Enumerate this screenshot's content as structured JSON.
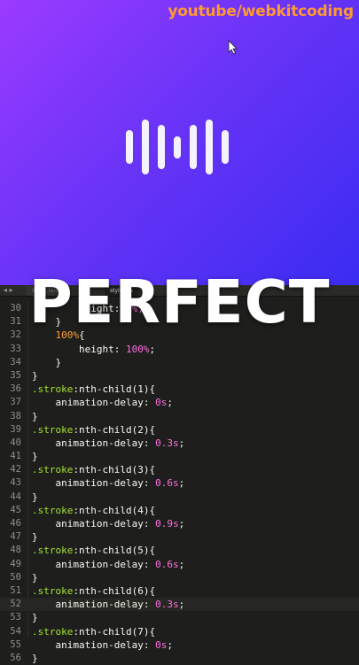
{
  "preview": {
    "watermark": "youtube/webkitcoding",
    "loader_levels": [
      0.62,
      1.0,
      0.8,
      0.4,
      0.8,
      1.0,
      0.62
    ]
  },
  "caption": "PERFECT",
  "editor": {
    "tabs": [
      {
        "label": "index.html",
        "active": false
      },
      {
        "label": "style.css",
        "active": true
      }
    ],
    "lines": [
      {
        "n": "30",
        "parts": [
          [
            "        height: ",
            "c-prop"
          ],
          [
            "0%;",
            "c-num"
          ]
        ]
      },
      {
        "n": "31",
        "parts": [
          [
            "    }",
            "c-white"
          ]
        ]
      },
      {
        "n": "32",
        "parts": [
          [
            "    ",
            "c-white"
          ],
          [
            "100%",
            "c-pct"
          ],
          [
            "{",
            "c-white"
          ]
        ]
      },
      {
        "n": "33",
        "parts": [
          [
            "        height: ",
            "c-prop"
          ],
          [
            "100%",
            "c-num"
          ],
          [
            ";",
            "c-white"
          ]
        ]
      },
      {
        "n": "34",
        "parts": [
          [
            "    }",
            "c-white"
          ]
        ]
      },
      {
        "n": "35",
        "parts": [
          [
            "}",
            "c-white"
          ]
        ]
      },
      {
        "n": "36",
        "parts": [
          [
            ".stroke",
            "c-sel"
          ],
          [
            ":nth-child(1){",
            "c-white"
          ]
        ]
      },
      {
        "n": "37",
        "parts": [
          [
            "    animation-delay: ",
            "c-prop"
          ],
          [
            "0s",
            "c-num"
          ],
          [
            ";",
            "c-white"
          ]
        ]
      },
      {
        "n": "38",
        "parts": [
          [
            "}",
            "c-white"
          ]
        ]
      },
      {
        "n": "39",
        "parts": [
          [
            ".stroke",
            "c-sel"
          ],
          [
            ":nth-child(2){",
            "c-white"
          ]
        ]
      },
      {
        "n": "40",
        "parts": [
          [
            "    animation-delay: ",
            "c-prop"
          ],
          [
            "0.3s",
            "c-num"
          ],
          [
            ";",
            "c-white"
          ]
        ]
      },
      {
        "n": "41",
        "parts": [
          [
            "}",
            "c-white"
          ]
        ]
      },
      {
        "n": "42",
        "parts": [
          [
            ".stroke",
            "c-sel"
          ],
          [
            ":nth-child(3){",
            "c-white"
          ]
        ]
      },
      {
        "n": "43",
        "parts": [
          [
            "    animation-delay: ",
            "c-prop"
          ],
          [
            "0.6s",
            "c-num"
          ],
          [
            ";",
            "c-white"
          ]
        ]
      },
      {
        "n": "44",
        "parts": [
          [
            "}",
            "c-white"
          ]
        ]
      },
      {
        "n": "45",
        "parts": [
          [
            ".stroke",
            "c-sel"
          ],
          [
            ":nth-child(4){",
            "c-white"
          ]
        ]
      },
      {
        "n": "46",
        "parts": [
          [
            "    animation-delay: ",
            "c-prop"
          ],
          [
            "0.9s",
            "c-num"
          ],
          [
            ";",
            "c-white"
          ]
        ]
      },
      {
        "n": "47",
        "parts": [
          [
            "}",
            "c-white"
          ]
        ]
      },
      {
        "n": "48",
        "parts": [
          [
            ".stroke",
            "c-sel"
          ],
          [
            ":nth-child(5){",
            "c-white"
          ]
        ]
      },
      {
        "n": "49",
        "parts": [
          [
            "    animation-delay: ",
            "c-prop"
          ],
          [
            "0.6s",
            "c-num"
          ],
          [
            ";",
            "c-white"
          ]
        ]
      },
      {
        "n": "50",
        "parts": [
          [
            "}",
            "c-white"
          ]
        ]
      },
      {
        "n": "51",
        "parts": [
          [
            ".stroke",
            "c-sel"
          ],
          [
            ":nth-child(6){",
            "c-white"
          ]
        ]
      },
      {
        "n": "52",
        "parts": [
          [
            "    animation-delay: ",
            "c-prop"
          ],
          [
            "0.3s",
            "c-num"
          ],
          [
            ";",
            "c-white"
          ]
        ],
        "current": true
      },
      {
        "n": "53",
        "parts": [
          [
            "}",
            "c-white"
          ]
        ]
      },
      {
        "n": "54",
        "parts": [
          [
            ".stroke",
            "c-sel"
          ],
          [
            ":nth-child(7){",
            "c-white"
          ]
        ]
      },
      {
        "n": "55",
        "parts": [
          [
            "    animation-delay: ",
            "c-prop"
          ],
          [
            "0s",
            "c-num"
          ],
          [
            ";",
            "c-white"
          ]
        ]
      },
      {
        "n": "56",
        "parts": [
          [
            "}",
            "c-white"
          ]
        ]
      }
    ]
  },
  "colors": {
    "selector": "#a6e22e",
    "number": "#ff6ee0",
    "percent": "#ff9d3c",
    "watermark": "#ff9a2e"
  }
}
